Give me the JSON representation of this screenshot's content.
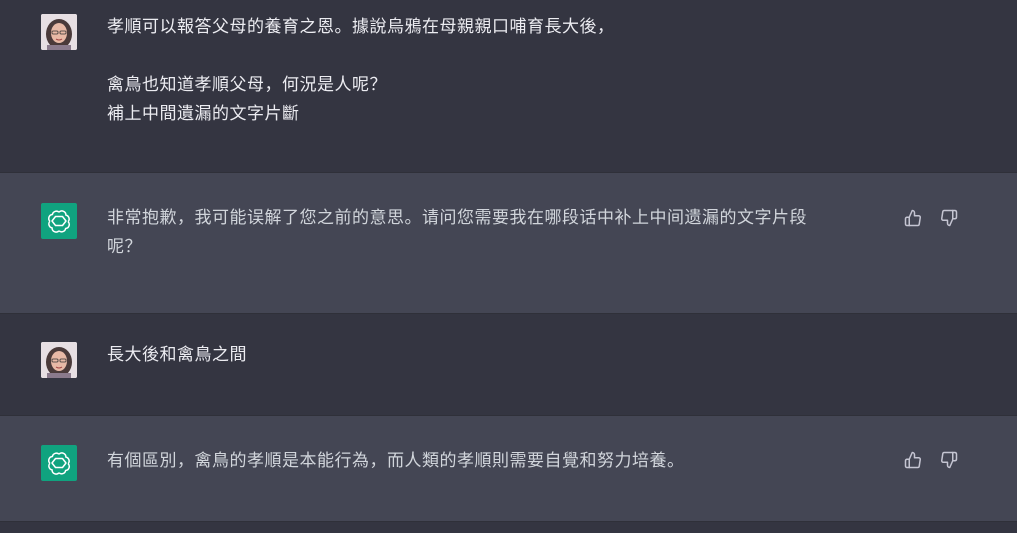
{
  "messages": [
    {
      "role": "user",
      "lines": [
        "孝順可以報答父母的養育之恩。據說烏鴉在母親親口哺育長大後，",
        "",
        "禽鳥也知道孝順父母，何況是人呢？",
        "補上中間遺漏的文字片斷"
      ]
    },
    {
      "role": "assistant",
      "lines": [
        "非常抱歉，我可能误解了您之前的意思。请问您需要我在哪段话中补上中间遗漏的文字片段",
        "呢？"
      ]
    },
    {
      "role": "user",
      "lines": [
        "長大後和禽鳥之間"
      ]
    },
    {
      "role": "assistant",
      "lines": [
        "有個區別，禽鳥的孝順是本能行為，而人類的孝順則需要自覺和努力培養。"
      ]
    }
  ],
  "icons": {
    "user_avatar": "user-avatar-photo",
    "assistant_avatar": "openai-logo-icon",
    "like": "thumbs-up-icon",
    "dislike": "thumbs-down-icon"
  },
  "colors": {
    "user_bg": "#343541",
    "assistant_bg": "#444654",
    "brand": "#10a37f",
    "text": "#ececf1"
  }
}
